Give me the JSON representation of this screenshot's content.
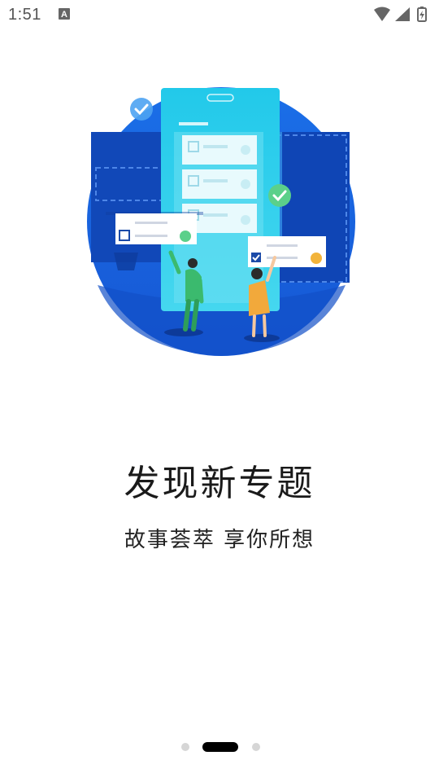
{
  "status_bar": {
    "time": "1:51",
    "notification_icon": "a-notification-icon",
    "wifi_icon": "wifi-icon",
    "signal_icon": "cell-signal-icon",
    "battery_icon": "battery-charging-icon"
  },
  "onboarding": {
    "illustration": "team-task-board-illustration",
    "title": "发现新专题",
    "subtitle": "故事荟萃 享你所想",
    "pages": 3,
    "current_page": 2
  },
  "colors": {
    "accent_blue": "#1565E0",
    "phone_cyan": "#1EC8E8",
    "check_green": "#5BD08A",
    "indicator_active": "#000000",
    "indicator_inactive": "#D6D6D6"
  }
}
